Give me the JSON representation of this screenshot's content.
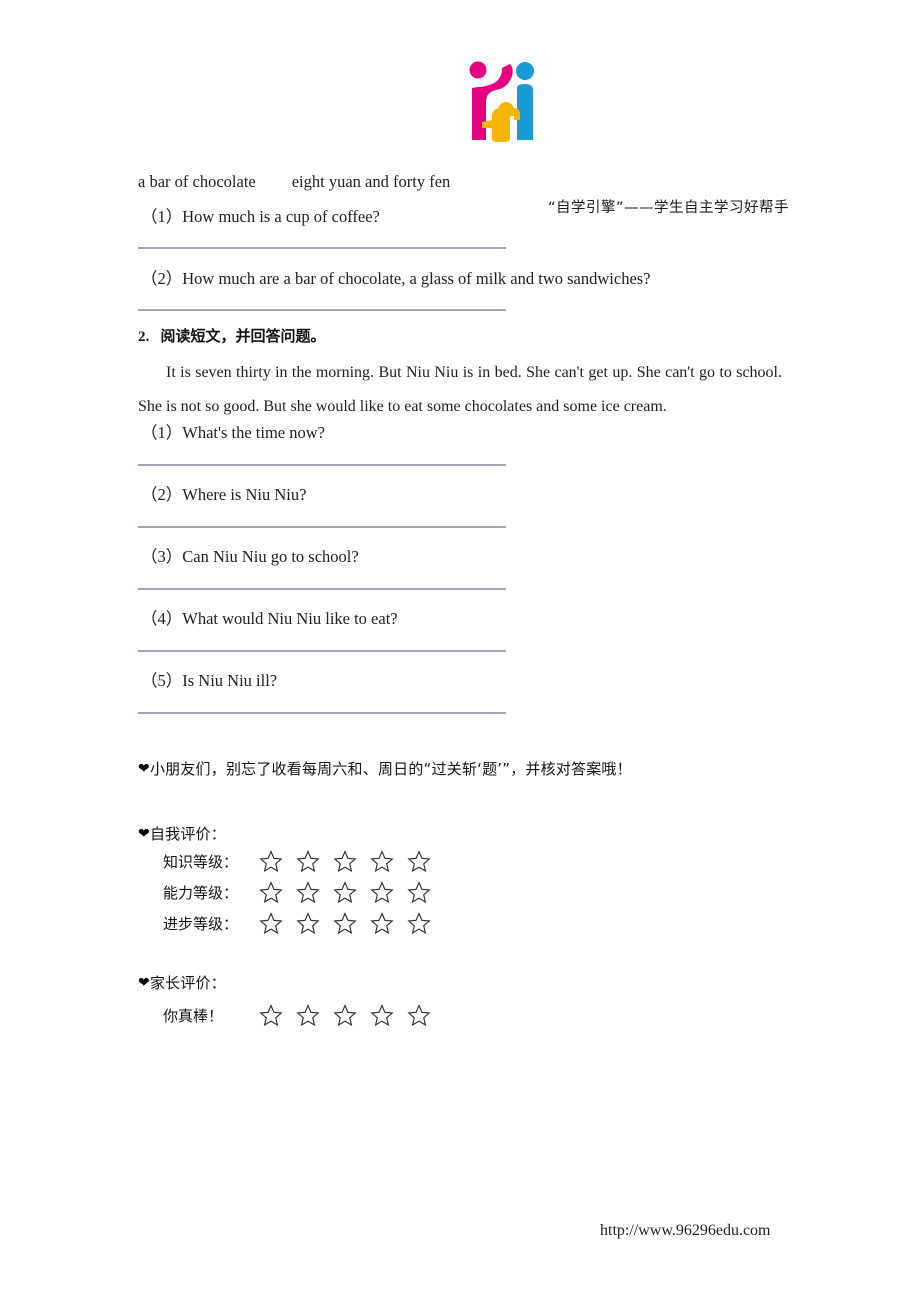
{
  "header": {
    "logo_name": "self-study-engine-logo",
    "logo_colors": {
      "magenta": "#e5007f",
      "yellow": "#f5b400",
      "blue": "#1a9ad7"
    },
    "tagline": "“自学引擎”——学生自主学习好帮手"
  },
  "section1": {
    "price_line_left": "a bar of chocolate",
    "price_line_right": "eight yuan and forty fen",
    "questions": [
      "（1）How much is a cup of coffee?",
      "（2）How much are a bar of chocolate, a glass of milk and two sandwiches?"
    ]
  },
  "section2": {
    "number": "2.",
    "title": "阅读短文，并回答问题。",
    "passage": "It is seven thirty in the morning. But Niu Niu is in bed. She can't get up. She can't go to school. She is not so good. But she would like to eat some chocolates and some ice cream.",
    "questions": [
      "（1）What's the time now?",
      "（2）Where is Niu Niu?",
      "（3）Can Niu Niu go to school?",
      "（4）What would Niu Niu like to eat?",
      "（5）Is Niu Niu ill?"
    ]
  },
  "reminder": {
    "bullet": "❤",
    "text": "小朋友们，别忘了收看每周六和、周日的“过关斩‘题’”，并核对答案哦！"
  },
  "self_evaluation": {
    "bullet": "❤",
    "title": "自我评价：",
    "rows": [
      {
        "label": "知识等级：",
        "stars": 5,
        "filled": 0
      },
      {
        "label": "能力等级：",
        "stars": 5,
        "filled": 0
      },
      {
        "label": "进步等级：",
        "stars": 5,
        "filled": 0
      }
    ]
  },
  "parent_evaluation": {
    "bullet": "❤",
    "title": "家长评价：",
    "rows": [
      {
        "label": "你真棒！",
        "stars": 5,
        "filled": 0
      }
    ]
  },
  "footer": {
    "url": "http://www.96296edu.com"
  }
}
